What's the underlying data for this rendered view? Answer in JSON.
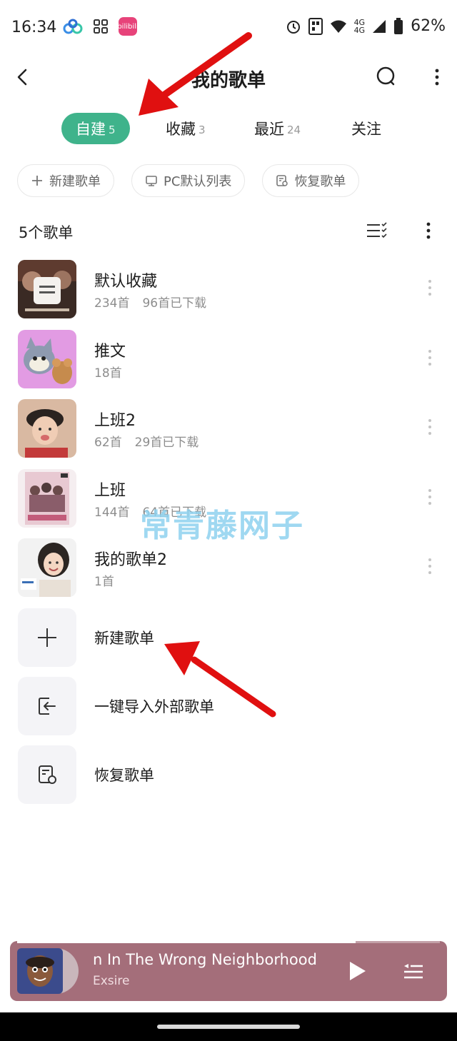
{
  "status_bar": {
    "time": "16:34",
    "app_badge": "bilibili",
    "network_top": "4G",
    "network_bottom": "4G",
    "battery": "62%"
  },
  "header": {
    "title": "我的歌单"
  },
  "tabs": [
    {
      "label": "自建",
      "count": "5",
      "active": true
    },
    {
      "label": "收藏",
      "count": "3",
      "active": false
    },
    {
      "label": "最近",
      "count": "24",
      "active": false
    },
    {
      "label": "关注",
      "count": "",
      "active": false
    }
  ],
  "chips": [
    {
      "label": "新建歌单",
      "icon": "plus-icon"
    },
    {
      "label": "PC默认列表",
      "icon": "monitor-icon"
    },
    {
      "label": "恢复歌单",
      "icon": "restore-icon"
    }
  ],
  "list": {
    "count_label": "5个歌单"
  },
  "playlists": [
    {
      "name": "默认收藏",
      "songs": "234首",
      "downloaded": "96首已下载"
    },
    {
      "name": "推文",
      "songs": "18首",
      "downloaded": ""
    },
    {
      "name": "上班2",
      "songs": "62首",
      "downloaded": "29首已下载"
    },
    {
      "name": "上班",
      "songs": "144首",
      "downloaded": "64首已下载"
    },
    {
      "name": "我的歌单2",
      "songs": "1首",
      "downloaded": ""
    }
  ],
  "actions": [
    {
      "label": "新建歌单",
      "icon": "plus-icon"
    },
    {
      "label": "一键导入外部歌单",
      "icon": "import-icon"
    },
    {
      "label": "恢复歌单",
      "icon": "restore-icon"
    }
  ],
  "watermark": "常青藤网子",
  "player": {
    "title": "n In The Wrong Neighborhood",
    "artist": "Exsire",
    "progress": 0.8
  },
  "colors": {
    "accent": "#3fb38b",
    "player_bg": "#a46e7a",
    "annotation": "#e01010"
  }
}
